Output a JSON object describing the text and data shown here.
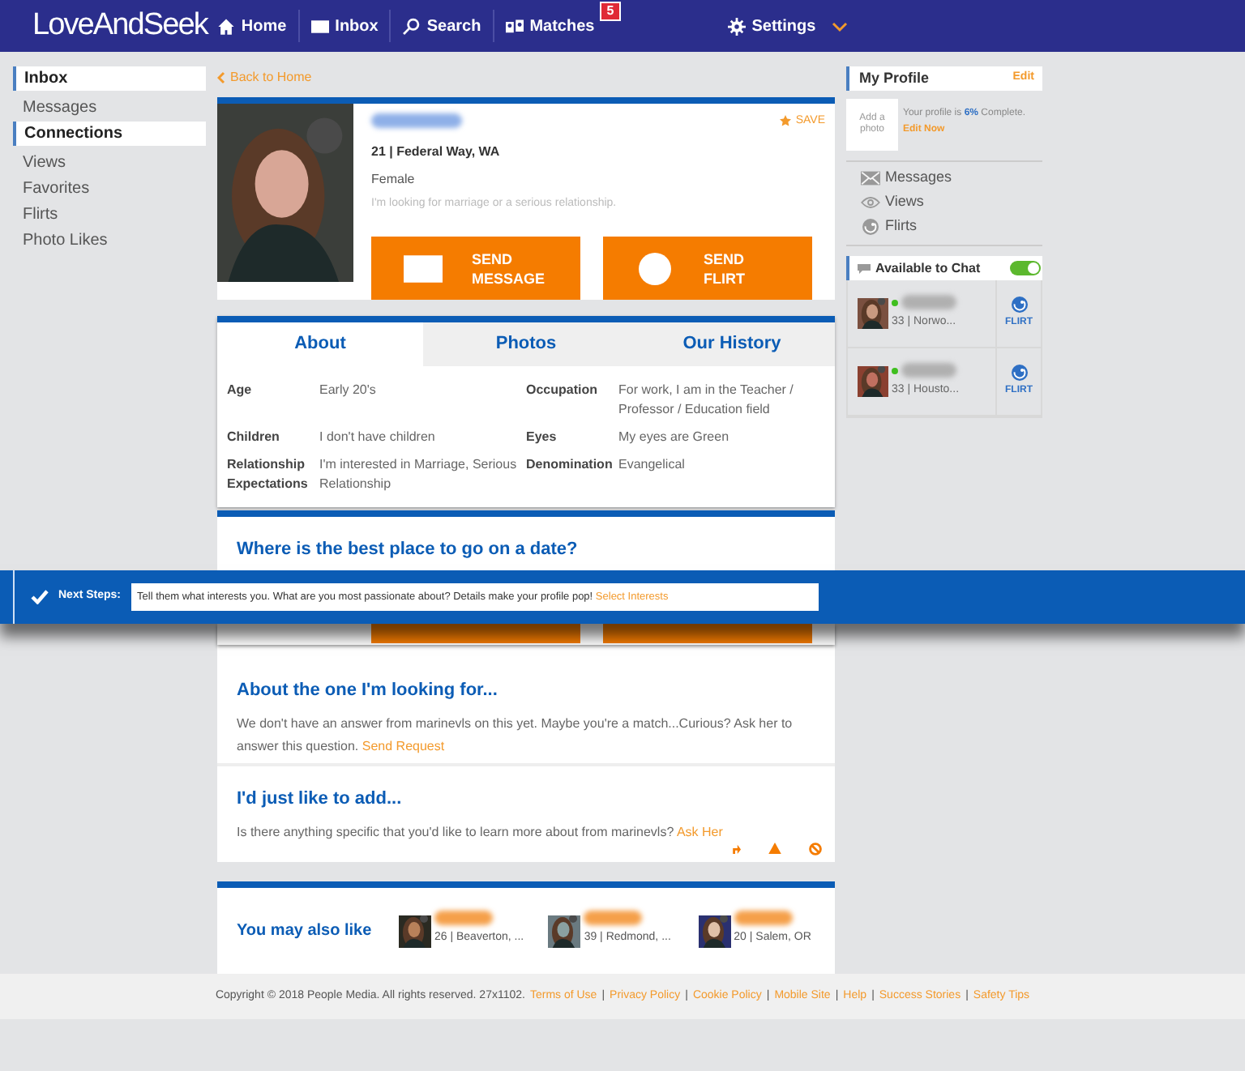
{
  "header": {
    "logo": "LoveAndSeek",
    "nav": [
      {
        "label": "Home",
        "kind": "home"
      },
      {
        "label": "Inbox",
        "kind": "mail"
      },
      {
        "label": "Search",
        "kind": "search"
      },
      {
        "label": "Matches",
        "kind": "matches",
        "badge": "5"
      }
    ],
    "settings": "Settings"
  },
  "sidebar": {
    "sections": [
      {
        "title": "Inbox",
        "items": [
          "Messages"
        ]
      },
      {
        "title": "Connections",
        "items": [
          "Views",
          "Favorites",
          "Flirts",
          "Photo Likes"
        ]
      }
    ]
  },
  "back_link": "Back to Home",
  "profile": {
    "save": "SAVE",
    "details": "21 | Federal Way, WA",
    "gender": "Female",
    "looking_for": "I'm looking for marriage or a serious relationship.",
    "buttons": [
      {
        "label": "SEND MESSAGE",
        "kind": "mail"
      },
      {
        "label": "SEND FLIRT",
        "kind": "smile"
      }
    ]
  },
  "tabs": [
    {
      "label": "About",
      "selected": true
    },
    {
      "label": "Photos",
      "selected": false
    },
    {
      "label": "Our History",
      "selected": false
    }
  ],
  "about": [
    {
      "label": "Age",
      "value": "Early 20's"
    },
    {
      "label": "Occupation",
      "value": "For work, I am in the Teacher / Professor / Education field"
    },
    {
      "label": "Children",
      "value": "I don't have children"
    },
    {
      "label": "Eyes",
      "value": "My eyes are Green"
    },
    {
      "label": "Relationship Expectations",
      "value": "I'm interested in Marriage, Serious Relationship"
    },
    {
      "label": "Denomination",
      "value": "Evangelical"
    }
  ],
  "questions": [
    {
      "title": "Where is the best place to go on a date?"
    },
    {
      "title": "About the one I'm looking for...",
      "text": "We don't have an answer from marinevls on this yet. Maybe you're a match...Curious? Ask her to answer this question.",
      "link": "Send Request"
    },
    {
      "title": "I'd just like to add...",
      "text": "Is there anything specific that you'd like to learn more about from marinevls?",
      "link": "Ask Her"
    }
  ],
  "suggestions": {
    "title": "You may also like",
    "people": [
      {
        "details": "26 | Beaverton, ..."
      },
      {
        "details": "39 | Redmond, ..."
      },
      {
        "details": "20 | Salem, OR"
      }
    ]
  },
  "my_profile": {
    "title": "My Profile",
    "edit": "Edit",
    "photo_hint": "Add a photo",
    "completion": "Your profile is **6%** Complete.",
    "edit_now": "Edit Now",
    "links": [
      {
        "label": "Messages",
        "kind": "mail"
      },
      {
        "label": "Views",
        "kind": "eye"
      },
      {
        "label": "Flirts",
        "kind": "smile"
      }
    ]
  },
  "chat": {
    "title": "Available to Chat",
    "on": true,
    "users": [
      {
        "details": "33 | Norwo...",
        "online": true,
        "flirt": "FLIRT"
      },
      {
        "details": "33 | Housto...",
        "online": true,
        "flirt": "FLIRT"
      }
    ]
  },
  "next_steps": {
    "label": "Next Steps:",
    "text": "Tell them what interests you. What are you most passionate about? Details make your profile pop!",
    "link": "Select Interests"
  },
  "footer": {
    "copyright": "Copyright © 2018 People Media. All rights reserved. 27x1102.",
    "links": [
      "Terms of Use",
      "Privacy Policy",
      "Cookie Policy",
      "Mobile Site",
      "Help",
      "Success Stories",
      "Safety Tips"
    ],
    "separator": "|"
  }
}
